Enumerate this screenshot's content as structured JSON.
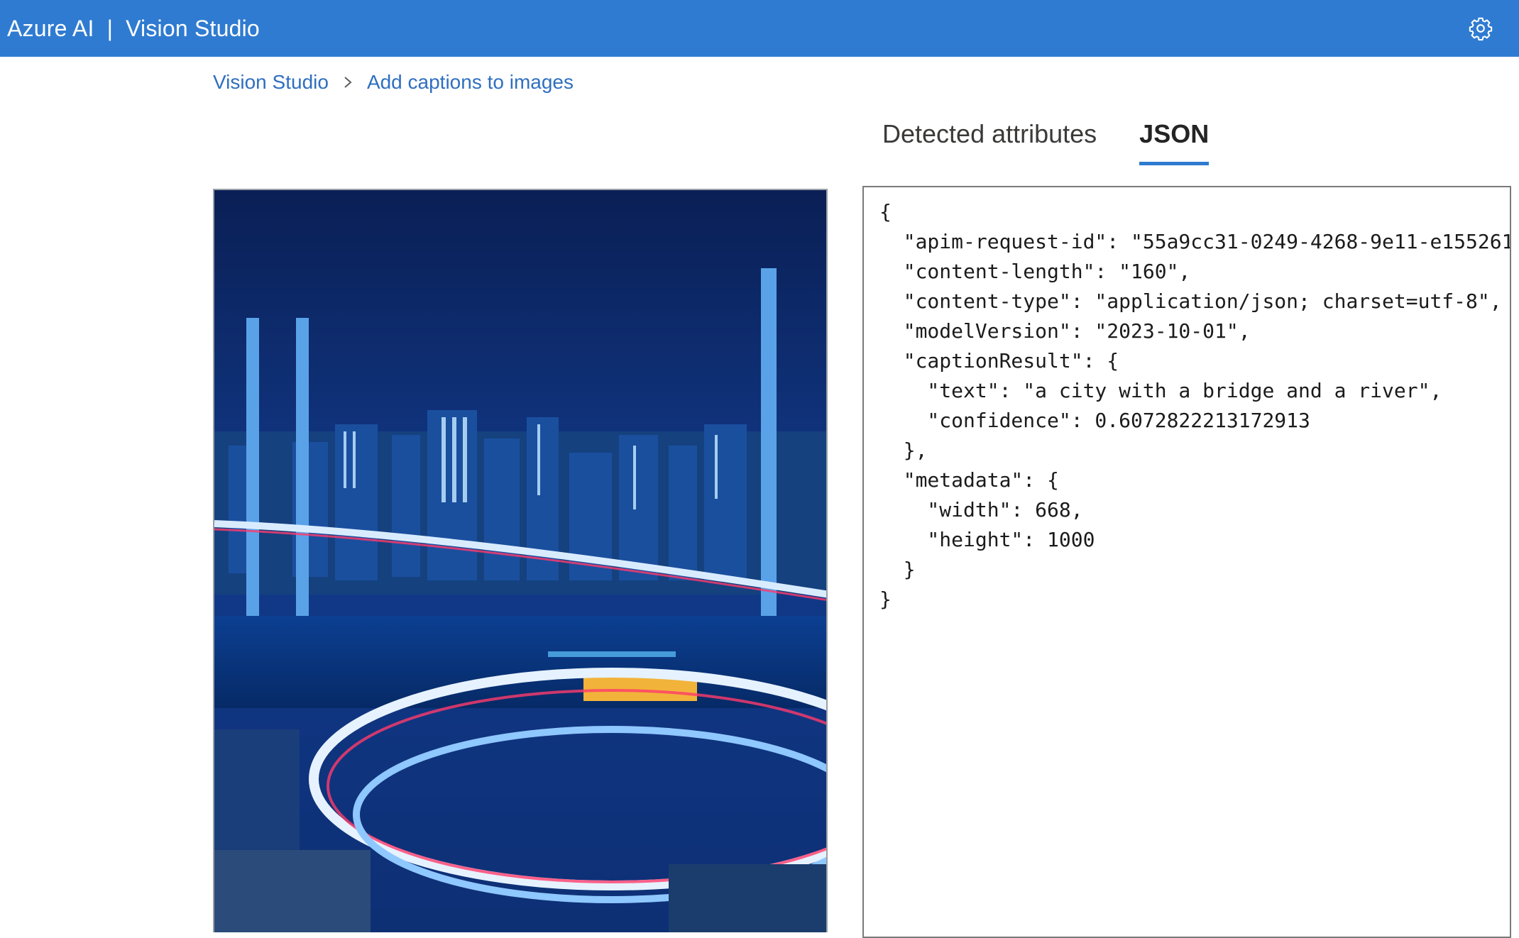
{
  "header": {
    "brand": "Azure AI",
    "separator": "|",
    "product": "Vision Studio",
    "settings_icon": "gear-icon"
  },
  "breadcrumb": {
    "items": [
      "Vision Studio",
      "Add captions to images"
    ],
    "separator_icon": "chevron-right-icon"
  },
  "tabs": [
    {
      "label": "Detected attributes",
      "active": false
    },
    {
      "label": "JSON",
      "active": true
    }
  ],
  "image": {
    "content": "night city bridge photo"
  },
  "json_output": {
    "lines": [
      "{",
      "  \"apim-request-id\": \"55a9cc31-0249-4268-9e11-e155261",
      "  \"content-length\": \"160\",",
      "  \"content-type\": \"application/json; charset=utf-8\",",
      "  \"modelVersion\": \"2023-10-01\",",
      "  \"captionResult\": {",
      "    \"text\": \"a city with a bridge and a river\",",
      "    \"confidence\": 0.6072822213172913",
      "  },",
      "  \"metadata\": {",
      "    \"width\": 668,",
      "    \"height\": 1000",
      "  }",
      "}"
    ]
  },
  "colors": {
    "header_bg": "#2f7bd1",
    "link": "#2f6fc0",
    "tab_underline": "#2f7bd1"
  }
}
